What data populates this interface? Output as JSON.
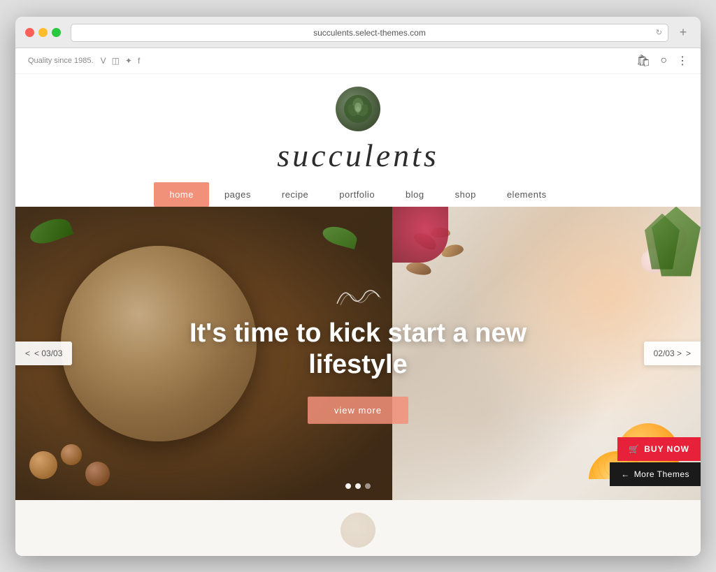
{
  "browser": {
    "url": "succulents.select-themes.com",
    "new_tab_icon": "+"
  },
  "topbar": {
    "quality_text": "Quality since 1985.",
    "social": [
      "V",
      "□",
      "✦",
      "f"
    ],
    "icons": {
      "bag": "🛍",
      "search": "🔍",
      "more": "⋮"
    }
  },
  "site": {
    "title": "succulents",
    "nav": {
      "items": [
        {
          "label": "home",
          "active": true
        },
        {
          "label": "pages",
          "active": false
        },
        {
          "label": "recipe",
          "active": false
        },
        {
          "label": "portfolio",
          "active": false
        },
        {
          "label": "blog",
          "active": false
        },
        {
          "label": "shop",
          "active": false
        },
        {
          "label": "elements",
          "active": false
        }
      ]
    },
    "hero": {
      "script_text": "ffffo",
      "headline": "It's time to kick start a new lifestyle",
      "btn_label": "view more",
      "nav_left": "< 03/03",
      "nav_right": "02/03 >",
      "dots": [
        true,
        true,
        false
      ],
      "buy_now": "BUY NOW",
      "more_themes": "More Themes",
      "cart_icon": "🛒",
      "arrow_left": "←"
    }
  },
  "colors": {
    "accent": "#f2917a",
    "buy_now_red": "#e8213a",
    "more_themes_dark": "#1a1a1a",
    "nav_active": "#f2917a"
  }
}
